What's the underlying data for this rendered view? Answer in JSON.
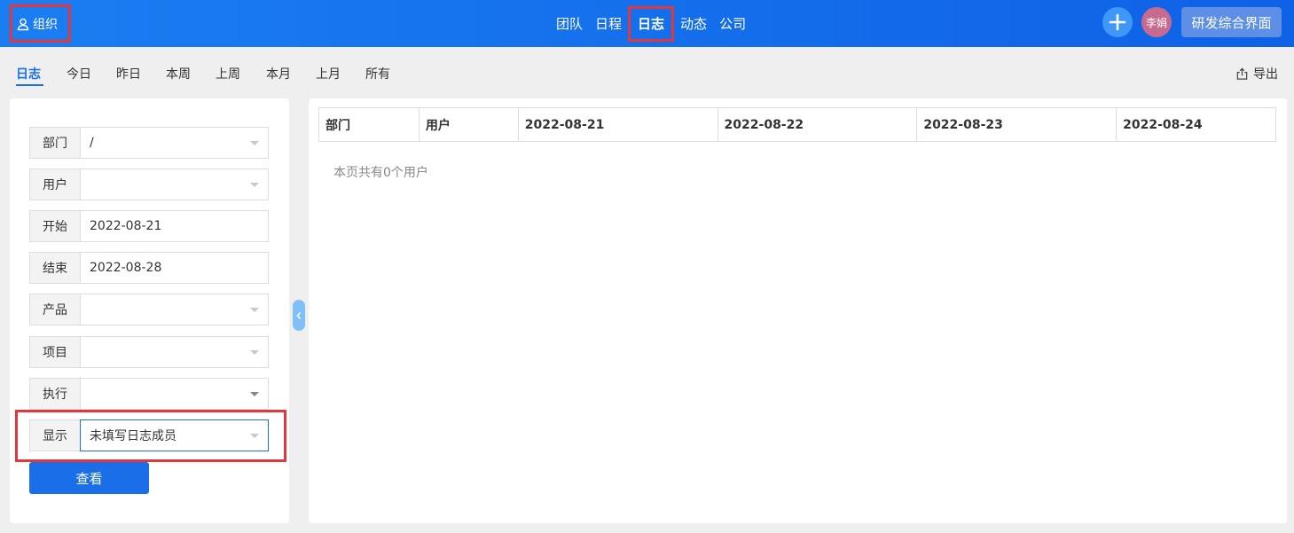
{
  "topbar": {
    "org_label": "组织",
    "nav": [
      {
        "label": "团队",
        "active": false
      },
      {
        "label": "日程",
        "active": false
      },
      {
        "label": "日志",
        "active": true
      },
      {
        "label": "动态",
        "active": false
      },
      {
        "label": "公司",
        "active": false
      }
    ],
    "avatar_text": "李娟",
    "app_switch_label": "研发综合界面"
  },
  "subnav": {
    "tabs": [
      {
        "label": "日志",
        "active": true
      },
      {
        "label": "今日",
        "active": false
      },
      {
        "label": "昨日",
        "active": false
      },
      {
        "label": "本周",
        "active": false
      },
      {
        "label": "上周",
        "active": false
      },
      {
        "label": "本月",
        "active": false
      },
      {
        "label": "上月",
        "active": false
      },
      {
        "label": "所有",
        "active": false
      }
    ],
    "export_label": "导出"
  },
  "filters": {
    "dept": {
      "label": "部门",
      "value": "/"
    },
    "user": {
      "label": "用户",
      "value": ""
    },
    "start": {
      "label": "开始",
      "value": "2022-08-21"
    },
    "end": {
      "label": "结束",
      "value": "2022-08-28"
    },
    "product": {
      "label": "产品",
      "value": ""
    },
    "project": {
      "label": "项目",
      "value": ""
    },
    "execution": {
      "label": "执行",
      "value": ""
    },
    "display": {
      "label": "显示",
      "value": "未填写日志成员"
    },
    "view_button": "查看"
  },
  "table": {
    "columns": [
      "部门",
      "用户",
      "2022-08-21",
      "2022-08-22",
      "2022-08-23",
      "2022-08-24"
    ],
    "empty_note": "本页共有0个用户"
  },
  "colors": {
    "topbar": "#1a7ef2",
    "accent": "#1a6ee8",
    "highlight": "#e2383d"
  }
}
